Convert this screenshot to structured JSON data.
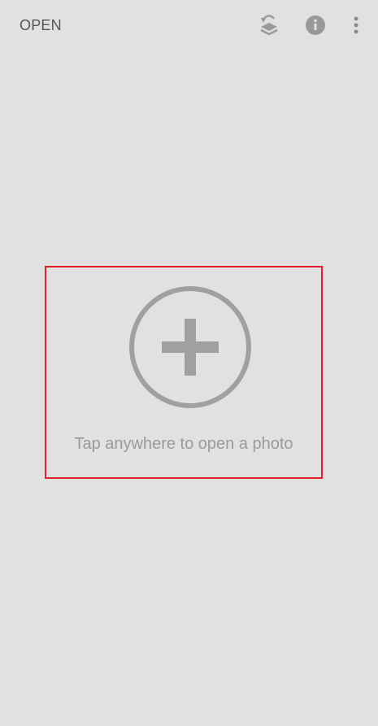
{
  "toolbar": {
    "open_label": "OPEN",
    "icons": {
      "layers": "layers-swap-icon",
      "info": "info-icon",
      "more": "more-vert-icon"
    },
    "icon_color": "#999999"
  },
  "main": {
    "add_icon": "add-circle-icon",
    "hint_text": "Tap anywhere to open a photo",
    "highlight_color": "#e0202a",
    "add_icon_color": "#a0a0a0"
  }
}
